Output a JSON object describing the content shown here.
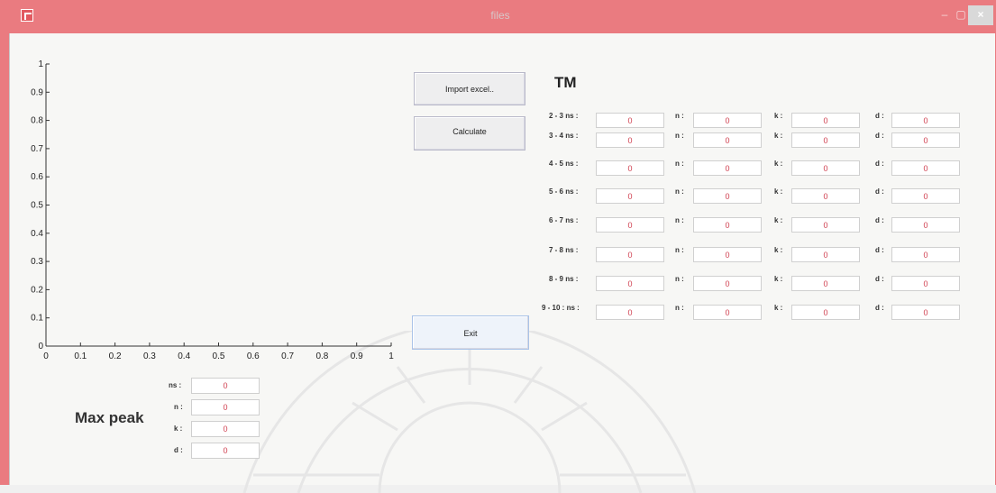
{
  "window": {
    "title": "files",
    "minimize": "–",
    "maximize": "▢",
    "close": "×"
  },
  "buttons": {
    "import": "Import excel..",
    "calculate": "Calculate",
    "exit": "Exit"
  },
  "tm": {
    "title": "TM",
    "rows": [
      {
        "label": "2 - 3 ns :",
        "ns": "0",
        "n": "0",
        "k": "0",
        "d": "0"
      },
      {
        "label": "3 - 4 ns :",
        "ns": "0",
        "n": "0",
        "k": "0",
        "d": "0"
      },
      {
        "label": "4 - 5 ns :",
        "ns": "0",
        "n": "0",
        "k": "0",
        "d": "0"
      },
      {
        "label": "5 - 6 ns :",
        "ns": "0",
        "n": "0",
        "k": "0",
        "d": "0"
      },
      {
        "label": "6 - 7 ns :",
        "ns": "0",
        "n": "0",
        "k": "0",
        "d": "0"
      },
      {
        "label": "7 - 8 ns :",
        "ns": "0",
        "n": "0",
        "k": "0",
        "d": "0"
      },
      {
        "label": "8 - 9 ns :",
        "ns": "0",
        "n": "0",
        "k": "0",
        "d": "0"
      },
      {
        "label": "9 - 10 : ns :",
        "ns": "0",
        "n": "0",
        "k": "0",
        "d": "0"
      }
    ],
    "col_labels": {
      "n": "n :",
      "k": "k :",
      "d": "d :"
    }
  },
  "max_peak": {
    "title": "Max peak",
    "fields": [
      {
        "label": "ns :",
        "value": "0"
      },
      {
        "label": "n :",
        "value": "0"
      },
      {
        "label": "k :",
        "value": "0"
      },
      {
        "label": "d :",
        "value": "0"
      }
    ]
  },
  "axes": {
    "xticks": [
      "0",
      "0.1",
      "0.2",
      "0.3",
      "0.4",
      "0.5",
      "0.6",
      "0.7",
      "0.8",
      "0.9",
      "1"
    ],
    "yticks": [
      "0",
      "0.1",
      "0.2",
      "0.3",
      "0.4",
      "0.5",
      "0.6",
      "0.7",
      "0.8",
      "0.9",
      "1"
    ]
  }
}
